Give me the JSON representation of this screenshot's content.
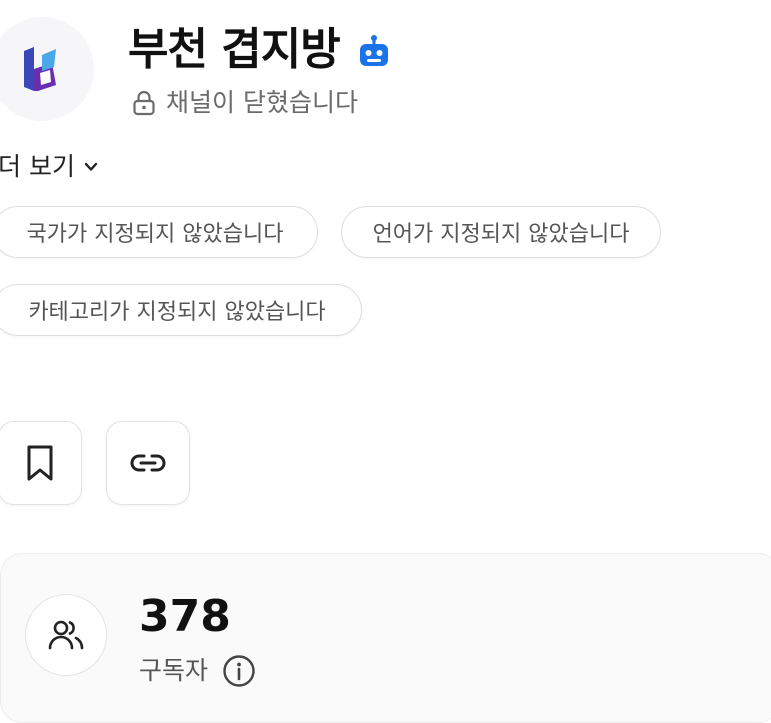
{
  "channel": {
    "name": "부천 겹지방",
    "status": "채널이 닫혔습니다",
    "more_label": "더 보기",
    "logo_colors": [
      "#3b46b8",
      "#6a2fb0",
      "#4aa8e8"
    ]
  },
  "tags": [
    {
      "label": "국가가 지정되지 않았습니다"
    },
    {
      "label": "언어가 지정되지 않았습니다"
    },
    {
      "label": "카테고리가 지정되지 않았습니다"
    }
  ],
  "actions": {
    "bookmark_icon": "bookmark-icon",
    "link_icon": "link-icon"
  },
  "stats": {
    "subscribers": "378",
    "subscribers_label": "구독자",
    "icon": "users-icon"
  },
  "colors": {
    "accent": "#1a73e8",
    "muted_text": "#6b6b6b"
  }
}
